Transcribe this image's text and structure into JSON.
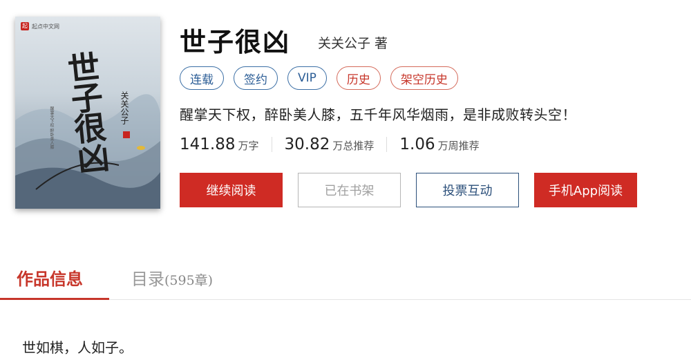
{
  "cover": {
    "brand": "起点中文网",
    "logo": "起",
    "title": "世子很凶",
    "author": "关关公子",
    "subtitle": "醒掌天下权 醉卧美人膝"
  },
  "book": {
    "title": "世子很凶",
    "author": "关关公子 著",
    "intro": "醒掌天下权，醉卧美人膝，五千年风华烟雨，是非成败转头空！"
  },
  "tags": [
    {
      "label": "连载",
      "color": "#2b5d96"
    },
    {
      "label": "签约",
      "color": "#2b5d96"
    },
    {
      "label": "VIP",
      "color": "#2b5d96"
    },
    {
      "label": "历史",
      "color": "#c7362a"
    },
    {
      "label": "架空历史",
      "color": "#c7362a"
    }
  ],
  "stats": [
    {
      "value": "141.88",
      "unit": "万字"
    },
    {
      "value": "30.82",
      "unit": "万总推荐"
    },
    {
      "value": "1.06",
      "unit": "万周推荐"
    }
  ],
  "buttons": {
    "read": "继续阅读",
    "shelf": "已在书架",
    "vote": "投票互动",
    "app": "手机App阅读"
  },
  "tabs": {
    "info": "作品信息",
    "catalog": "目录",
    "catalog_count": "(595章)"
  },
  "content": {
    "first_line": "世如棋，人如子。"
  },
  "colors": {
    "accent_red": "#cf2b24",
    "tag_blue": "#2b5d96",
    "tag_red": "#c7362a"
  }
}
